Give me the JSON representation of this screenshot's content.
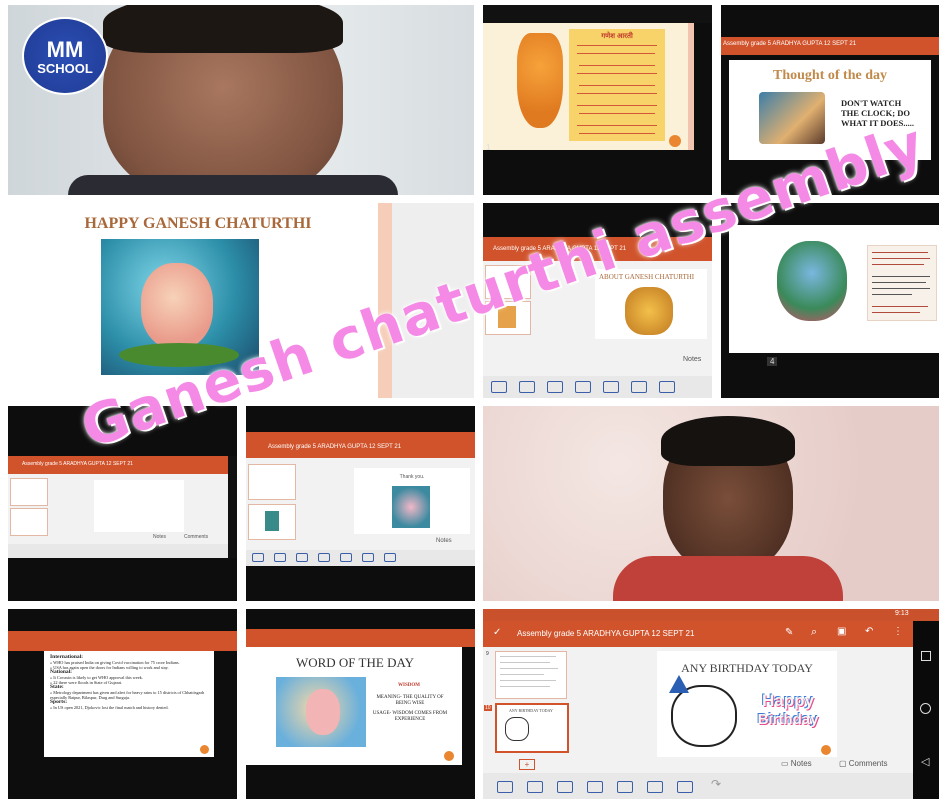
{
  "logo": {
    "line1": "MM",
    "line2": "SCHOOL"
  },
  "watermark": "Ganesh chaturthi assembly",
  "tiles": {
    "aarti": {
      "title": "गणेश आरती",
      "page": "1"
    },
    "thought": {
      "app_bar": "Assembly grade 5 ARADHYA GUPTA 12 SEPT 21",
      "heading": "Thought of the day",
      "quote": "DON'T WATCH THE CLOCK; DO WHAT IT DOES....."
    },
    "happy_ganesh": {
      "heading": "HAPPY GANESH CHATURTHI"
    },
    "about": {
      "app_bar": "Assembly grade 5 ARADHYA GUPTA 12 SEPT 21",
      "heading": "ABOUT GANESH CHATURTHI",
      "notes": "Notes"
    },
    "mantra": {
      "page": "4"
    },
    "small_left": {
      "app_bar": "Assembly grade 5 ARADHYA GUPTA 12 SEPT 21",
      "notes": "Notes",
      "comments": "Comments"
    },
    "small_mid": {
      "app_bar": "Assembly grade 5 ARADHYA GUPTA 12 SEPT 21",
      "slide_text": "Thank you.",
      "notes": "Notes"
    },
    "news": {
      "lines": [
        {
          "label": "International:",
          "text": ""
        },
        {
          "label": "",
          "text": "» WHO has praised India on giving Covid vaccination for 75 crore Indians."
        },
        {
          "label": "",
          "text": "» USA has again open the doors for Indians willing to work and stay."
        },
        {
          "label": "National:",
          "text": ""
        },
        {
          "label": "",
          "text": "» It Covaxin is likely to get WHO approval this week."
        },
        {
          "label": "",
          "text": "» 22 there were floods in State of Gujarat."
        },
        {
          "label": "State:",
          "text": ""
        },
        {
          "label": "",
          "text": "» Metrology department has given and alert for heavy rains to 15 districts of Chhattisgarh especially Raipur, Bilaspur, Durg and Surguja."
        },
        {
          "label": "Sports:",
          "text": ""
        },
        {
          "label": "",
          "text": "» In US open 2021, Djokovic lost the final match and history denied."
        }
      ]
    },
    "word": {
      "heading": "WORD OF THE DAY",
      "word": "WISDOM",
      "meaning": "MEANING- THE QUALITY OF BEING WISE",
      "usage": "USAGE- WISDOM COMES FROM EXPERIENCE"
    },
    "birthday": {
      "time": "9:13",
      "app_bar": "Assembly grade 5 ARADHYA GUPTA 12 SEPT 21",
      "heading": "ANY BIRTHDAY TODAY",
      "card_line1": "Happy",
      "card_line2": "Birthday",
      "thumb_numbers": [
        "9",
        "10"
      ],
      "thumb_caption": "ANY BIRTHDAY TODAY",
      "notes": "Notes",
      "comments": "Comments"
    }
  },
  "colors": {
    "accent_orange": "#d0532c",
    "watermark_pink": "#f58ae6",
    "slide_title_brown": "#a9683a",
    "logo_blue": "#1f3a93"
  }
}
